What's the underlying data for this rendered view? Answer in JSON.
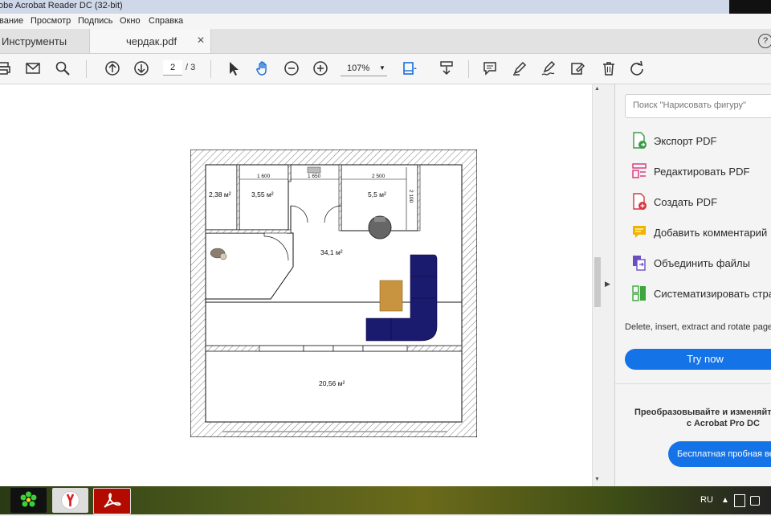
{
  "window": {
    "title": "obe Acrobat Reader DC (32-bit)"
  },
  "menu": [
    "вание",
    "Просмотр",
    "Подпись",
    "Окно",
    "Справка"
  ],
  "tabs": {
    "tools": "Инструменты",
    "document": "чердак.pdf",
    "close": "✕",
    "help": "?"
  },
  "toolbar": {
    "page_current": "2",
    "page_total": "/ 3",
    "zoom": "107%"
  },
  "icons": [
    "print-icon",
    "mail-icon",
    "search-icon",
    "prev-page-icon",
    "next-page-icon",
    "select-icon",
    "hand-icon",
    "zoom-out-icon",
    "zoom-in-icon",
    "fit-page-icon",
    "scroll-mode-icon",
    "comment-icon",
    "highlight-icon",
    "sign-icon",
    "edit-icon",
    "delete-icon",
    "rotate-icon"
  ],
  "plan": {
    "rooms": [
      "2,38 м²",
      "3,55 м²",
      "5,5 м²",
      "34,1 м²",
      "20,56 м²"
    ],
    "dims": [
      "1 600",
      "1 650",
      "2 500",
      "2 100"
    ]
  },
  "panel": {
    "search_placeholder": "Поиск \"Нарисовать фигуру\"",
    "tools": [
      {
        "label": "Экспорт PDF",
        "icon": "export-pdf-icon",
        "color": "#3a9a47"
      },
      {
        "label": "Редактировать PDF",
        "icon": "edit-pdf-icon",
        "color": "#d9327a"
      },
      {
        "label": "Создать PDF",
        "icon": "create-pdf-icon",
        "color": "#d7373f"
      },
      {
        "label": "Добавить комментарий",
        "icon": "comment-icon",
        "color": "#f0b400"
      },
      {
        "label": "Объединить файлы",
        "icon": "combine-files-icon",
        "color": "#6b4fc1"
      },
      {
        "label": "Систематизировать стра",
        "icon": "organize-pages-icon",
        "color": "#3ea63e"
      }
    ],
    "description": "Delete, insert, extract and rotate pages",
    "try_button": "Try now",
    "promo_line1": "Преобразовывайте и изменяйте",
    "promo_line2": "с Acrobat Pro DC",
    "trial_button": "Бесплатная пробная верс"
  },
  "taskbar": {
    "lang": "RU",
    "tray": "▲"
  },
  "colors": {
    "accent": "#1473e6",
    "sofa": "#1a1a6e",
    "table": "#c99440"
  }
}
